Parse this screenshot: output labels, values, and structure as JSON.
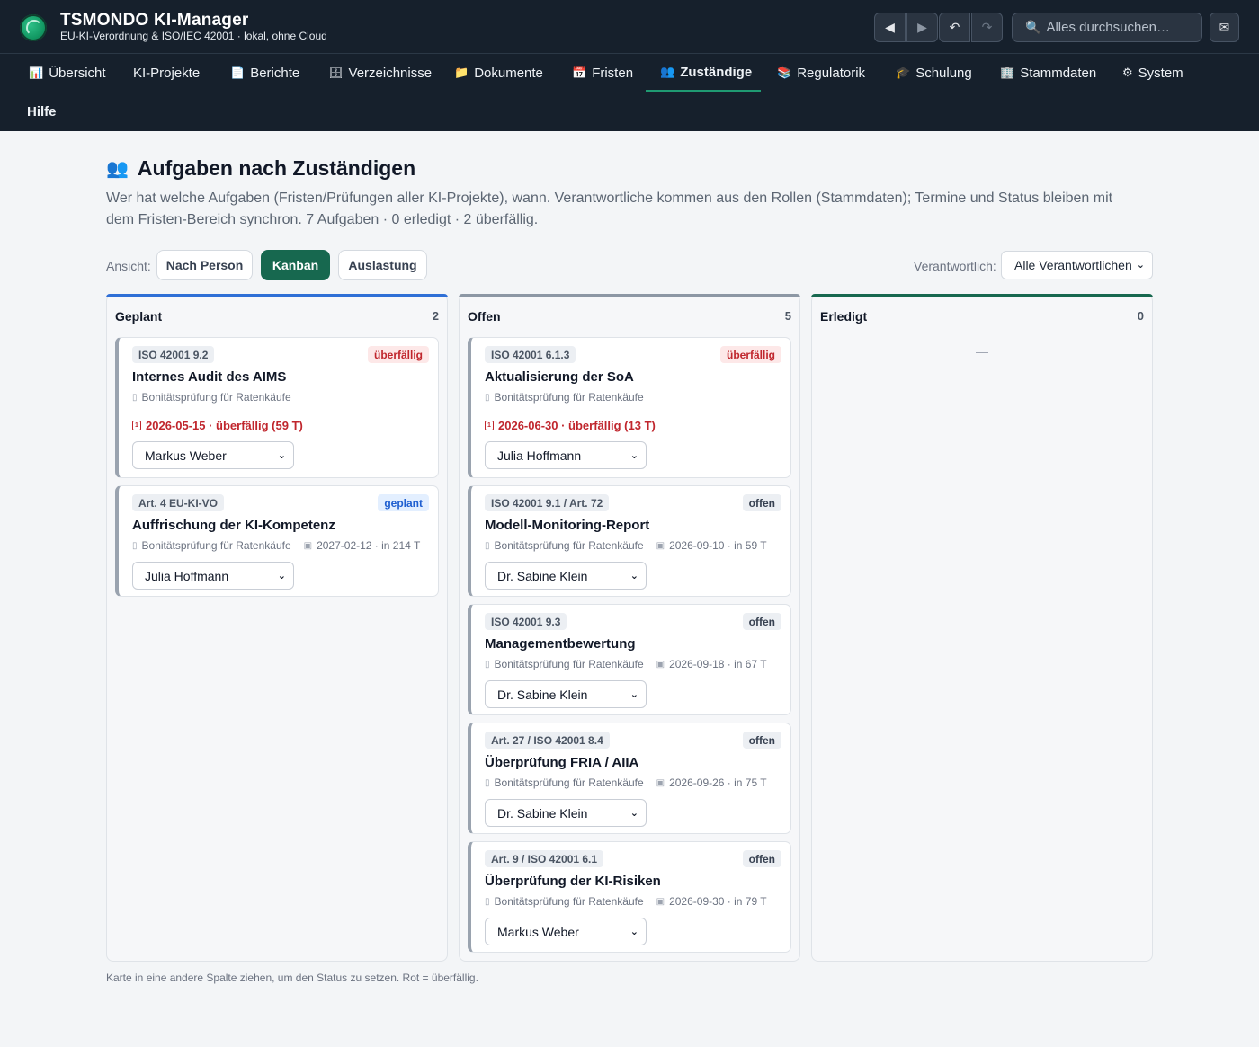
{
  "app": {
    "title": "TSMONDO KI-Manager",
    "subtitle": "EU-KI-Verordnung & ISO/IEC 42001 · lokal, ohne Cloud"
  },
  "toolbar": {
    "back": "◀",
    "forward": "▶",
    "undo": "↶",
    "redo": "↷",
    "search_placeholder": "Alles durchsuchen…",
    "mail": "✉"
  },
  "nav": [
    {
      "icon": "📊",
      "label": "Übersicht"
    },
    {
      "icon": "",
      "label": "KI-Projekte"
    },
    {
      "icon": "📄",
      "label": "Berichte"
    },
    {
      "icon": "🗄",
      "label": "Verzeichnisse"
    },
    {
      "icon": "📁",
      "label": "Dokumente"
    },
    {
      "icon": "📅",
      "label": "Fristen"
    },
    {
      "icon": "👥",
      "label": "Zuständige"
    },
    {
      "icon": "📚",
      "label": "Regulatorik"
    },
    {
      "icon": "🎓",
      "label": "Schulung"
    },
    {
      "icon": "🏢",
      "label": "Stammdaten"
    },
    {
      "icon": "⚙",
      "label": "System"
    },
    {
      "icon": "",
      "label": "Hilfe"
    }
  ],
  "page": {
    "icon": "👥",
    "title": "Aufgaben nach Zuständigen",
    "description": "Wer hat welche Aufgaben (Fristen/Prüfungen aller KI-Projekte), wann. Verantwortliche kommen aus den Rollen (Stammdaten); Termine und Status bleiben mit dem Fristen-Bereich synchron. 7 Aufgaben · 0 erledigt · 2 überfällig."
  },
  "view": {
    "label": "Ansicht:",
    "options": [
      "Nach Person",
      "Kanban",
      "Auslastung"
    ],
    "active": "Kanban",
    "responsible_label": "Verantwortlich:",
    "responsible_value": "Alle Verantwortlichen"
  },
  "columns": [
    {
      "name": "Geplant",
      "count": "2",
      "accent": "#2f6fd6",
      "empty": "",
      "cards": [
        {
          "tag": "ISO 42001 9.2",
          "status": "überfällig",
          "title": "Internes Audit des AIMS",
          "project": "Bonitätsprüfung für Ratenkäufe",
          "due": "2026-05-15 · überfällig (59 T)",
          "assignee": "Markus Weber"
        },
        {
          "tag": "Art. 4 EU-KI-VO",
          "status": "geplant",
          "title": "Auffrischung der KI-Kompetenz",
          "project": "Bonitätsprüfung für Ratenkäufe",
          "due": "2027-02-12 · in 214 T",
          "assignee": "Julia Hoffmann"
        }
      ]
    },
    {
      "name": "Offen",
      "count": "5",
      "accent": "#8c97a4",
      "empty": "",
      "cards": [
        {
          "tag": "ISO 42001 6.1.3",
          "status": "überfällig",
          "title": "Aktualisierung der SoA",
          "project": "Bonitätsprüfung für Ratenkäufe",
          "due": "2026-06-30 · überfällig (13 T)",
          "assignee": "Julia Hoffmann"
        },
        {
          "tag": "ISO 42001 9.1 / Art. 72",
          "status": "offen",
          "title": "Modell-Monitoring-Report",
          "project": "Bonitätsprüfung für Ratenkäufe",
          "due": "2026-09-10 · in 59 T",
          "assignee": "Dr. Sabine Klein"
        },
        {
          "tag": "ISO 42001 9.3",
          "status": "offen",
          "title": "Managementbewertung",
          "project": "Bonitätsprüfung für Ratenkäufe",
          "due": "2026-09-18 · in 67 T",
          "assignee": "Dr. Sabine Klein"
        },
        {
          "tag": "Art. 27 / ISO 42001 8.4",
          "status": "offen",
          "title": "Überprüfung FRIA / AIIA",
          "project": "Bonitätsprüfung für Ratenkäufe",
          "due": "2026-09-26 · in 75 T",
          "assignee": "Dr. Sabine Klein"
        },
        {
          "tag": "Art. 9 / ISO 42001 6.1",
          "status": "offen",
          "title": "Überprüfung der KI-Risiken",
          "project": "Bonitätsprüfung für Ratenkäufe",
          "due": "2026-09-30 · in 79 T",
          "assignee": "Markus Weber"
        }
      ]
    },
    {
      "name": "Erledigt",
      "count": "0",
      "accent": "#17684f",
      "empty": "—",
      "cards": []
    }
  ],
  "footnote": "Karte in eine andere Spalte ziehen, um den Status zu setzen. Rot = überfällig.",
  "colors": {
    "accent": "#17684f",
    "overdue": "#c0262d",
    "planned": "#1f5fd0"
  }
}
